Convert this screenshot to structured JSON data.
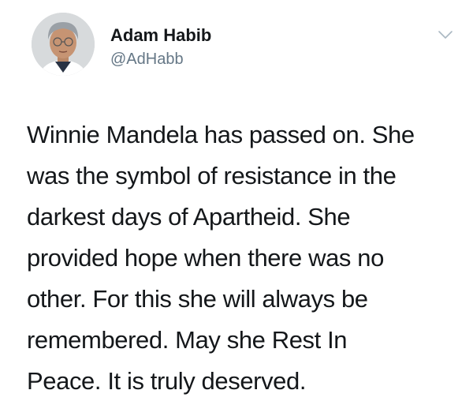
{
  "tweet": {
    "author": {
      "name": "Adam Habib",
      "handle": "@AdHabb"
    },
    "text_lines": [
      "Winnie Mandela has passed on. She",
      "was the symbol of resistance in the",
      "darkest days of Apartheid. She",
      "provided hope when there was no",
      "other. For this she will always be",
      "remembered. May she Rest In",
      "Peace. It is truly deserved."
    ],
    "icons": {
      "avatar": "profile-photo",
      "menu": "chevron-down-icon"
    }
  }
}
